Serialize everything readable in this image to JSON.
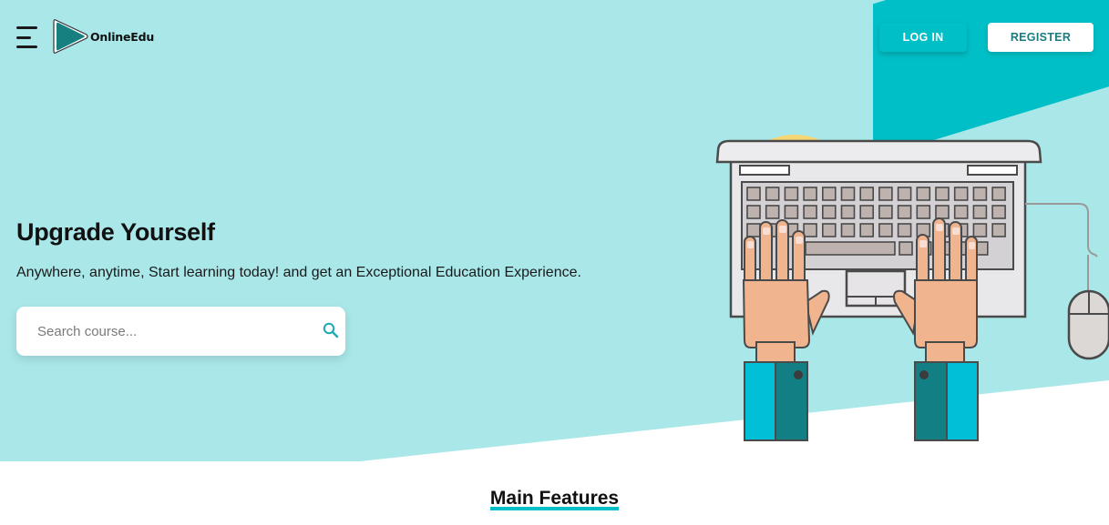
{
  "brand": {
    "name": "OnlineEdu"
  },
  "nav": {
    "login_label": "LOG IN",
    "register_label": "REGISTER"
  },
  "hero": {
    "title": "Upgrade Yourself",
    "subtitle": "Anywhere, anytime, Start learning today! and get an Exceptional Education Experience."
  },
  "search": {
    "placeholder": "Search course...",
    "value": ""
  },
  "features": {
    "title": "Main Features"
  },
  "colors": {
    "hero_bg": "#a9e7e9",
    "accent": "#00bfc6",
    "highlight": "#f6d774"
  },
  "icons": [
    "menu-icon",
    "logo-play-icon",
    "search-icon"
  ]
}
